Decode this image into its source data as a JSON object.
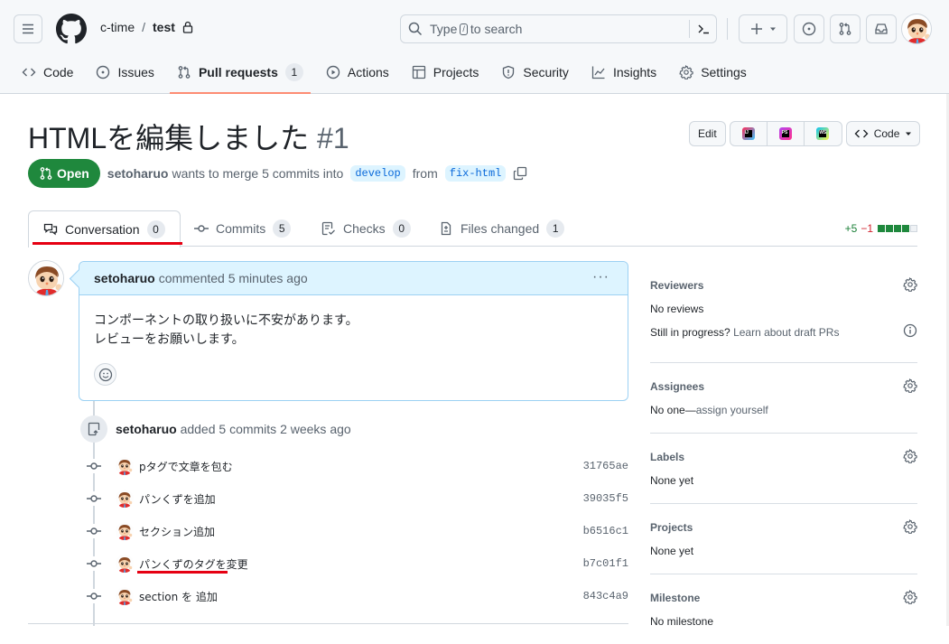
{
  "header": {
    "owner": "c-time",
    "separator": "/",
    "repo": "test",
    "search_placeholder_prefix": "Type",
    "search_key": "/",
    "search_placeholder_suffix": "to search"
  },
  "nav": {
    "items": [
      {
        "label": "Code",
        "icon": "code-icon"
      },
      {
        "label": "Issues",
        "icon": "issue-icon"
      },
      {
        "label": "Pull requests",
        "icon": "git-pull-request-icon",
        "count": "1",
        "selected": true
      },
      {
        "label": "Actions",
        "icon": "play-icon"
      },
      {
        "label": "Projects",
        "icon": "table-icon"
      },
      {
        "label": "Security",
        "icon": "shield-icon"
      },
      {
        "label": "Insights",
        "icon": "graph-icon"
      },
      {
        "label": "Settings",
        "icon": "gear-icon"
      }
    ]
  },
  "pr": {
    "title": "HTMLを編集しました",
    "number": "#1",
    "state": "Open",
    "author": "setoharuo",
    "merge_text": "wants to merge 5 commits into",
    "base_branch": "develop",
    "from_text": "from",
    "head_branch": "fix-html",
    "edit_label": "Edit",
    "code_label": "Code",
    "ides": [
      "IJ",
      "PS",
      "WS"
    ]
  },
  "tabs": [
    {
      "label": "Conversation",
      "count": "0",
      "selected": true
    },
    {
      "label": "Commits",
      "count": "5"
    },
    {
      "label": "Checks",
      "count": "0"
    },
    {
      "label": "Files changed",
      "count": "1"
    }
  ],
  "diffstat": {
    "additions": "+5",
    "deletions": "−1",
    "blocks": [
      "add",
      "add",
      "add",
      "add",
      "neutral"
    ]
  },
  "comment": {
    "author": "setoharuo",
    "meta": "commented 5 minutes ago",
    "more": "···",
    "lines": [
      "コンポーネントの取り扱いに不安があります。",
      "レビューをお願いします。"
    ]
  },
  "event": {
    "author": "setoharuo",
    "text": "added 5 commits 2 weeks ago"
  },
  "commits": [
    {
      "message": "pタグで文章を包む",
      "sha": "31765ae"
    },
    {
      "message": "パンくずを追加",
      "sha": "39035f5"
    },
    {
      "message": "セクション追加",
      "sha": "b6516c1"
    },
    {
      "message": "パンくずのタグを変更",
      "sha": "b7c01f1",
      "annotated": true
    },
    {
      "message": "section を 追加",
      "sha": "843c4a9"
    }
  ],
  "sidebar": {
    "reviewers": {
      "title": "Reviewers",
      "value": "No reviews",
      "hint": "Still in progress?",
      "hint_link": "Learn about draft PRs"
    },
    "assignees": {
      "title": "Assignees",
      "value": "No one—",
      "link": "assign yourself"
    },
    "labels": {
      "title": "Labels",
      "value": "None yet"
    },
    "projects": {
      "title": "Projects",
      "value": "None yet"
    },
    "milestone": {
      "title": "Milestone",
      "value": "No milestone"
    }
  },
  "colors": {
    "open_green": "#1f883d",
    "annotation_red": "#e60012",
    "nav_underline": "#fd8c73"
  }
}
